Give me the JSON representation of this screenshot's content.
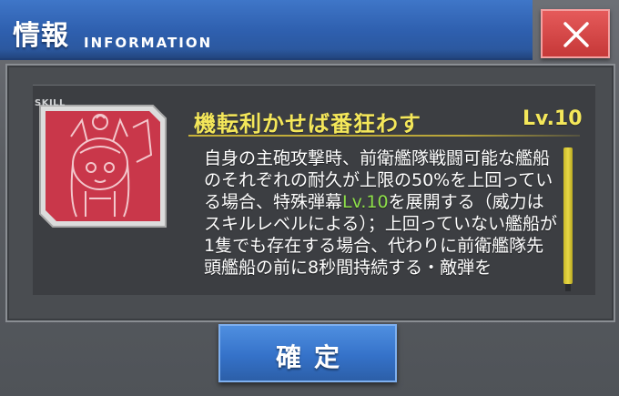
{
  "header": {
    "title_jp": "情報",
    "title_en": "INFORMATION"
  },
  "skill": {
    "tag": "SKILL",
    "name": "機転利かせば番狂わす",
    "level": "Lv.10",
    "description_before": "自身の主砲攻撃時、前衛艦隊戦闘可能な艦船のそれぞれの耐久が上限の50%を上回っている場合、特殊弾幕",
    "description_highlight": "Lv.10",
    "description_after": "を展開する（威力はスキルレベルによる）；上回っていない艦船が1隻でも存在する場合、代わりに前衛艦隊先頭艦船の前に8秒間持続する・敵弾を",
    "icon": "character-portrait-icon"
  },
  "buttons": {
    "confirm_label": "確定",
    "close_icon": "close-icon"
  },
  "colors": {
    "title_bar": "#2e5fae",
    "close_button": "#d94848",
    "skill_name": "#f4e75a",
    "highlight": "#8ee04a",
    "icon_bg": "#c83a4a"
  }
}
